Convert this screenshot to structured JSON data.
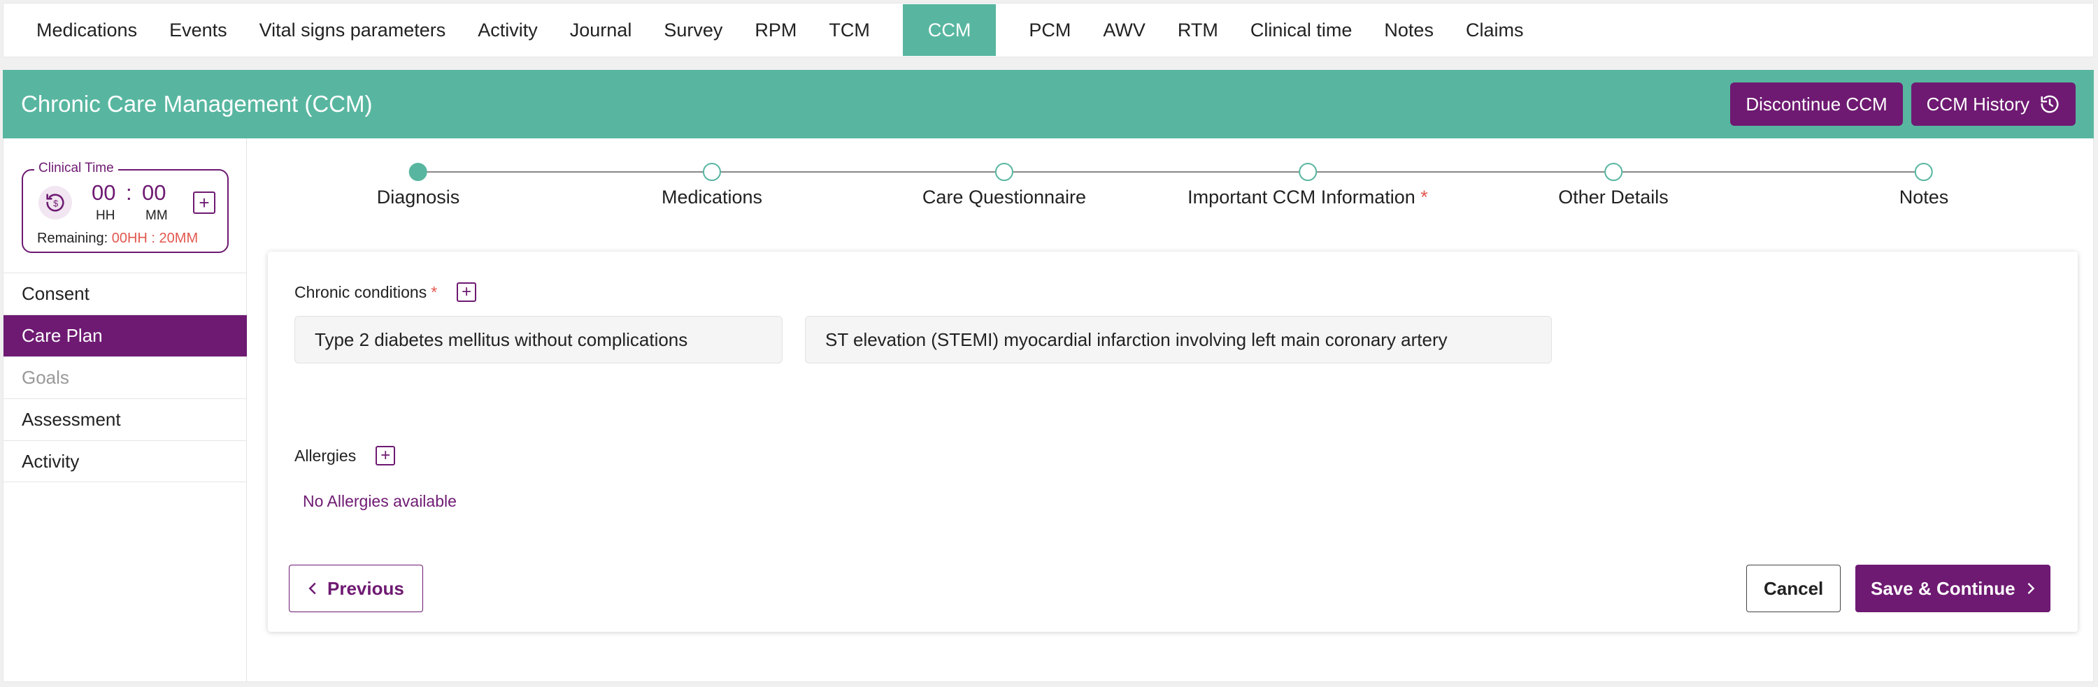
{
  "top_tabs": [
    "Medications",
    "Events",
    "Vital signs parameters",
    "Activity",
    "Journal",
    "Survey",
    "RPM",
    "TCM",
    "CCM",
    "PCM",
    "AWV",
    "RTM",
    "Clinical time",
    "Notes",
    "Claims"
  ],
  "active_tab": "CCM",
  "header": {
    "title": "Chronic Care Management (CCM)",
    "discontinue_label": "Discontinue CCM",
    "history_label": "CCM History"
  },
  "clinical_time": {
    "legend": "Clinical Time",
    "hours": "00",
    "separator": ":",
    "minutes": "00",
    "hh_label": "HH",
    "mm_label": "MM",
    "remaining_label": "Remaining:",
    "remaining_value": "00HH : 20MM",
    "add_symbol": "+"
  },
  "sidebar": {
    "items": [
      "Consent",
      "Care Plan",
      "Goals",
      "Assessment",
      "Activity"
    ],
    "active": "Care Plan",
    "disabled": "Goals"
  },
  "steps": [
    "Diagnosis",
    "Medications",
    "Care Questionnaire",
    "Important CCM Information",
    "Other Details",
    "Notes"
  ],
  "step_required_mark": "*",
  "active_step": "Diagnosis",
  "form": {
    "chronic_label": "Chronic conditions",
    "required_mark": "*",
    "conditions": [
      "Type 2 diabetes mellitus without complications",
      "ST elevation (STEMI) myocardial infarction involving left main coronary artery"
    ],
    "allergies_label": "Allergies",
    "no_allergies": "No Allergies available",
    "add_symbol": "+"
  },
  "actions": {
    "previous": "Previous",
    "cancel": "Cancel",
    "save": "Save & Continue"
  },
  "colors": {
    "teal": "#58b6a0",
    "purple": "#6e1a72",
    "required_red": "#e2584f"
  },
  "icons": {
    "history": "history-icon",
    "timer": "timer-icon",
    "chevron_left": "chevron-left-icon",
    "chevron_right": "chevron-right-icon"
  }
}
